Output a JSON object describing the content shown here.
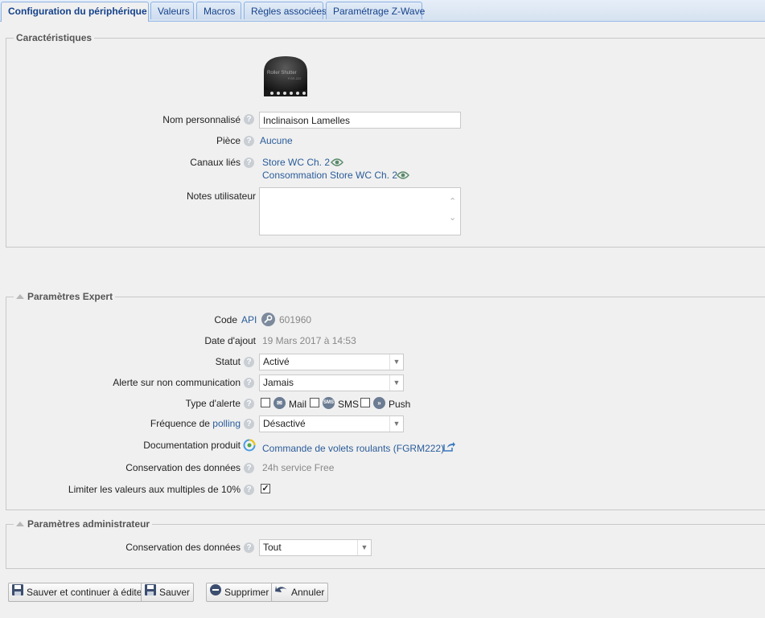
{
  "tabs": [
    {
      "label": "Configuration du périphérique",
      "active": true
    },
    {
      "label": "Valeurs"
    },
    {
      "label": "Macros"
    },
    {
      "label": "Règles associées"
    },
    {
      "label": "Paramétrage Z-Wave"
    }
  ],
  "characteristics": {
    "legend": "Caractéristiques",
    "device_image_text": "Roller Shutter",
    "device_image_subtext": "FGR-222",
    "name_label": "Nom personnalisé",
    "name_value": "Inclinaison Lamelles",
    "room_label": "Pièce",
    "room_value": "Aucune",
    "channels_label": "Canaux liés",
    "channels": [
      "Store WC Ch. 2",
      "Consommation Store WC Ch. 2"
    ],
    "notes_label": "Notes utilisateur",
    "notes_value": ""
  },
  "expert": {
    "legend": "Paramètres Expert",
    "code_label": "Code",
    "code_link": "API",
    "code_value": "601960",
    "date_label": "Date d'ajout",
    "date_value": "19 Mars 2017 à 14:53",
    "status_label": "Statut",
    "status_value": "Activé",
    "alert_label": "Alerte sur non communication",
    "alert_value": "Jamais",
    "alert_type_label": "Type d'alerte",
    "alert_types": [
      "Mail",
      "SMS",
      "Push"
    ],
    "polling_label_prefix": "Fréquence de",
    "polling_link": "polling",
    "polling_value": "Désactivé",
    "doc_label": "Documentation produit",
    "doc_value": "Commande de volets roulants (FGRM222)",
    "retention_label": "Conservation des données",
    "retention_value": "24h service Free",
    "limit_label": "Limiter les valeurs aux multiples de 10%",
    "limit_checked": true
  },
  "admin": {
    "legend": "Paramètres administrateur",
    "retention_label": "Conservation des données",
    "retention_value": "Tout"
  },
  "buttons": {
    "save_continue": "Sauver et continuer à éditer",
    "save": "Sauver",
    "delete": "Supprimer",
    "cancel": "Annuler"
  },
  "colors": {
    "link": "#2a5c9a",
    "tab_text": "#15428b"
  }
}
